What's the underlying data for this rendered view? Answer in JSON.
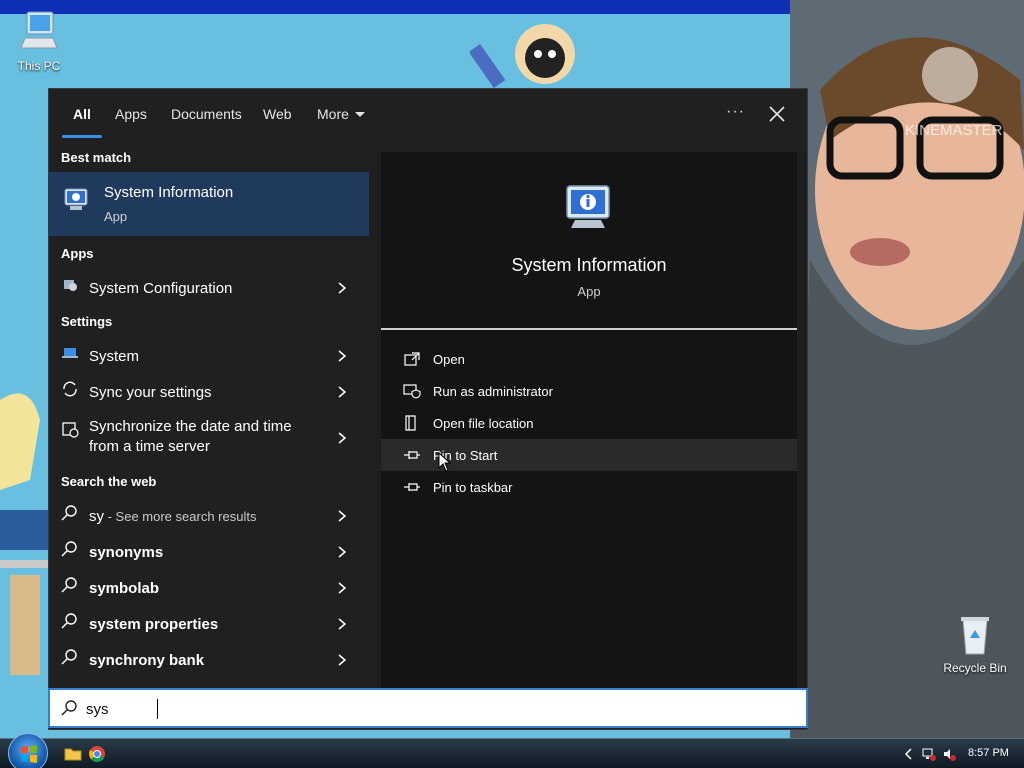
{
  "desktop": {
    "this_pc_label": "This PC",
    "recycle_bin_label": "Recycle Bin",
    "watermark": "KINEMASTER"
  },
  "tabs": [
    {
      "label": "All",
      "active": true
    },
    {
      "label": "Apps"
    },
    {
      "label": "Documents"
    },
    {
      "label": "Web"
    },
    {
      "label": "More"
    }
  ],
  "header": {
    "options_label": "···",
    "close": "close-icon"
  },
  "best_match": {
    "heading": "Best match",
    "title": "System Information",
    "subtitle": "App",
    "icon": "system-information-icon"
  },
  "apps": {
    "heading": "Apps",
    "items": [
      {
        "label": "System Configuration",
        "icon": "system-configuration-icon"
      }
    ]
  },
  "settings": {
    "heading": "Settings",
    "items": [
      {
        "label": "System",
        "icon": "laptop-icon"
      },
      {
        "label": "Sync your settings",
        "icon": "sync-icon"
      },
      {
        "label_line1": "Synchronize the date and time",
        "label_line2": "from a time server",
        "icon": "calendar-clock-icon"
      }
    ]
  },
  "web": {
    "heading": "Search the web",
    "items": [
      {
        "label": "sy",
        "suffix": " - See more search results"
      },
      {
        "label": "synonyms"
      },
      {
        "label": "symbolab"
      },
      {
        "label": "system properties"
      },
      {
        "label": "synchrony bank"
      }
    ]
  },
  "preview": {
    "title": "System Information",
    "subtitle": "App",
    "actions": [
      {
        "label": "Open",
        "icon": "open-icon"
      },
      {
        "label": "Run as administrator",
        "icon": "shield-icon"
      },
      {
        "label": "Open file location",
        "icon": "folder-icon"
      },
      {
        "label": "Pin to Start",
        "icon": "pin-icon",
        "hovered": true
      },
      {
        "label": "Pin to taskbar",
        "icon": "pin-icon"
      }
    ]
  },
  "search": {
    "value": "sys"
  },
  "taskbar": {
    "time": "8:57 PM"
  },
  "colors": {
    "accent": "#3a8ee6",
    "panel": "#202020",
    "selected": "#1f3a5c"
  }
}
